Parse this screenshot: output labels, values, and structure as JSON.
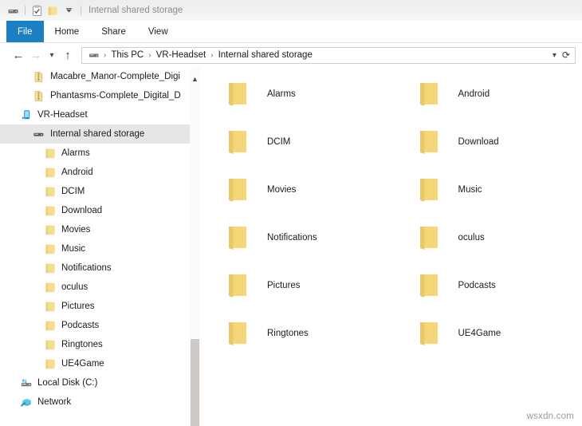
{
  "window": {
    "title": "Internal shared storage",
    "quick_access": [
      {
        "name": "device-icon",
        "label": "Device"
      },
      {
        "name": "properties-icon",
        "label": "Properties"
      },
      {
        "name": "new-folder-icon",
        "label": "New folder"
      },
      {
        "name": "customize-chevron-icon",
        "label": "Customize Quick Access Toolbar"
      }
    ]
  },
  "ribbon": {
    "tabs": [
      {
        "label": "File",
        "active": true
      },
      {
        "label": "Home",
        "active": false
      },
      {
        "label": "Share",
        "active": false
      },
      {
        "label": "View",
        "active": false
      }
    ]
  },
  "address_bar": {
    "back_label": "Back",
    "forward_label": "Forward",
    "recent_label": "Recent locations",
    "up_label": "Up",
    "breadcrumb": [
      "This PC",
      "VR-Headset",
      "Internal shared storage"
    ],
    "dropdown_label": "Previous locations",
    "refresh_label": "Refresh"
  },
  "sidebar": {
    "items": [
      {
        "label": "Macabre_Manor-Complete_Digi",
        "icon": "zip-icon",
        "level": "file",
        "selected": false
      },
      {
        "label": "Phantasms-Complete_Digital_D",
        "icon": "zip-icon",
        "level": "file",
        "selected": false
      },
      {
        "label": "VR-Headset",
        "icon": "portable-device-icon",
        "level": "device",
        "selected": false
      },
      {
        "label": "Internal shared storage",
        "icon": "storage-icon",
        "level": "storage",
        "selected": true
      },
      {
        "label": "Alarms",
        "icon": "folder-icon",
        "level": "folder",
        "selected": false
      },
      {
        "label": "Android",
        "icon": "folder-icon",
        "level": "folder",
        "selected": false
      },
      {
        "label": "DCIM",
        "icon": "folder-icon",
        "level": "folder",
        "selected": false
      },
      {
        "label": "Download",
        "icon": "folder-icon",
        "level": "folder",
        "selected": false
      },
      {
        "label": "Movies",
        "icon": "folder-icon",
        "level": "folder",
        "selected": false
      },
      {
        "label": "Music",
        "icon": "folder-icon",
        "level": "folder",
        "selected": false
      },
      {
        "label": "Notifications",
        "icon": "folder-icon",
        "level": "folder",
        "selected": false
      },
      {
        "label": "oculus",
        "icon": "folder-icon",
        "level": "folder",
        "selected": false
      },
      {
        "label": "Pictures",
        "icon": "folder-icon",
        "level": "folder",
        "selected": false
      },
      {
        "label": "Podcasts",
        "icon": "folder-icon",
        "level": "folder",
        "selected": false
      },
      {
        "label": "Ringtones",
        "icon": "folder-icon",
        "level": "folder",
        "selected": false
      },
      {
        "label": "UE4Game",
        "icon": "folder-icon",
        "level": "folder",
        "selected": false
      },
      {
        "label": "Local Disk (C:)",
        "icon": "hard-drive-icon",
        "level": "disk",
        "selected": false
      },
      {
        "label": "Network",
        "icon": "network-icon",
        "level": "net",
        "selected": false
      }
    ],
    "scroll_up_label": "Scroll up"
  },
  "content": {
    "folders": [
      {
        "label": "Alarms"
      },
      {
        "label": "Android"
      },
      {
        "label": "DCIM"
      },
      {
        "label": "Download"
      },
      {
        "label": "Movies"
      },
      {
        "label": "Music"
      },
      {
        "label": "Notifications"
      },
      {
        "label": "oculus"
      },
      {
        "label": "Pictures"
      },
      {
        "label": "Podcasts"
      },
      {
        "label": "Ringtones"
      },
      {
        "label": "UE4Game"
      }
    ]
  },
  "watermark": {
    "text": "wsxdn.com"
  },
  "colors": {
    "accent_blue": "#1b7fc4",
    "folder_yellow": "#f5d77a",
    "selection_gray": "#e6e6e6",
    "titlebar_gray": "#eff1f0"
  }
}
